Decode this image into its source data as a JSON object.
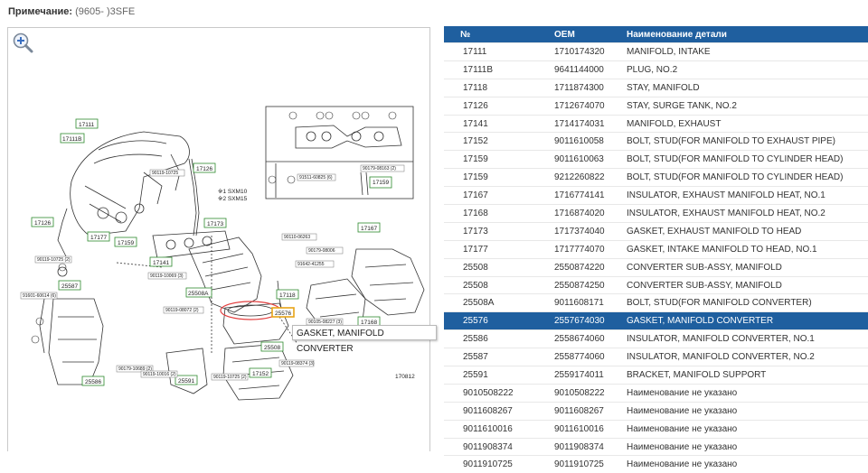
{
  "note": {
    "label": "Примечание:",
    "value": "(9605- )3SFE"
  },
  "diagram": {
    "code": "170812",
    "legend1": "※1 SXM10",
    "legend2": "※2 SXM15",
    "labels": [
      "17111",
      "17111B",
      "17126",
      "17177",
      "17159",
      "17173",
      "17167",
      "17141",
      "25508A",
      "25508",
      "25576",
      "17168",
      "17118",
      "25587",
      "25586",
      "25591",
      "17152",
      "17126"
    ],
    "small": [
      "90119-10725",
      "90119-10069",
      "90119-08072",
      "90105-08227",
      "90179-08163",
      "91511-60825",
      "90119-06374",
      "90179-08006",
      "91642-41255",
      "90119-08374",
      "90179-10689",
      "90119-10016",
      "91601-60614",
      "90119-10725",
      "90110-06263"
    ]
  },
  "tooltip": "GASKET, MANIFOLD CONVERTER",
  "table": {
    "headers": [
      "№",
      "OEM",
      "Наименование детали"
    ],
    "rows": [
      [
        "17111",
        "1710174320",
        "MANIFOLD, INTAKE"
      ],
      [
        "17111B",
        "9641144000",
        "PLUG, NO.2"
      ],
      [
        "17118",
        "1711874300",
        "STAY, MANIFOLD"
      ],
      [
        "17126",
        "1712674070",
        "STAY, SURGE TANK, NO.2"
      ],
      [
        "17141",
        "1714174031",
        "MANIFOLD, EXHAUST"
      ],
      [
        "17152",
        "9011610058",
        "BOLT, STUD(FOR MANIFOLD TO EXHAUST PIPE)"
      ],
      [
        "17159",
        "9011610063",
        "BOLT, STUD(FOR MANIFOLD TO CYLINDER HEAD)"
      ],
      [
        "17159",
        "9212260822",
        "BOLT, STUD(FOR MANIFOLD TO CYLINDER HEAD)"
      ],
      [
        "17167",
        "1716774141",
        "INSULATOR, EXHAUST MANIFOLD HEAT, NO.1"
      ],
      [
        "17168",
        "1716874020",
        "INSULATOR, EXHAUST MANIFOLD HEAT, NO.2"
      ],
      [
        "17173",
        "1717374040",
        "GASKET, EXHAUST MANIFOLD TO HEAD"
      ],
      [
        "17177",
        "1717774070",
        "GASKET, INTAKE MANIFOLD TO HEAD, NO.1"
      ],
      [
        "25508",
        "2550874220",
        "CONVERTER SUB-ASSY, MANIFOLD"
      ],
      [
        "25508",
        "2550874250",
        "CONVERTER SUB-ASSY, MANIFOLD"
      ],
      [
        "25508A",
        "9011608171",
        "BOLT, STUD(FOR MANIFOLD CONVERTER)"
      ],
      [
        "25576",
        "2557674030",
        "GASKET, MANIFOLD CONVERTER"
      ],
      [
        "25586",
        "2558674060",
        "INSULATOR, MANIFOLD CONVERTER, NO.1"
      ],
      [
        "25587",
        "2558774060",
        "INSULATOR, MANIFOLD CONVERTER, NO.2"
      ],
      [
        "25591",
        "2559174011",
        "BRACKET, MANIFOLD SUPPORT"
      ],
      [
        "9010508222",
        "9010508222",
        "Наименование не указано"
      ],
      [
        "9011608267",
        "9011608267",
        "Наименование не указано"
      ],
      [
        "9011610016",
        "9011610016",
        "Наименование не указано"
      ],
      [
        "9011908374",
        "9011908374",
        "Наименование не указано"
      ],
      [
        "9011910725",
        "9011910725",
        "Наименование не указано"
      ]
    ],
    "selected_index": 15
  },
  "colors": {
    "header_bg": "#1f5f9f",
    "selected_bg": "#1f5f9f",
    "label_green": "#2e8b2e",
    "highlight": "#e8a317",
    "ring": "#e34040"
  }
}
